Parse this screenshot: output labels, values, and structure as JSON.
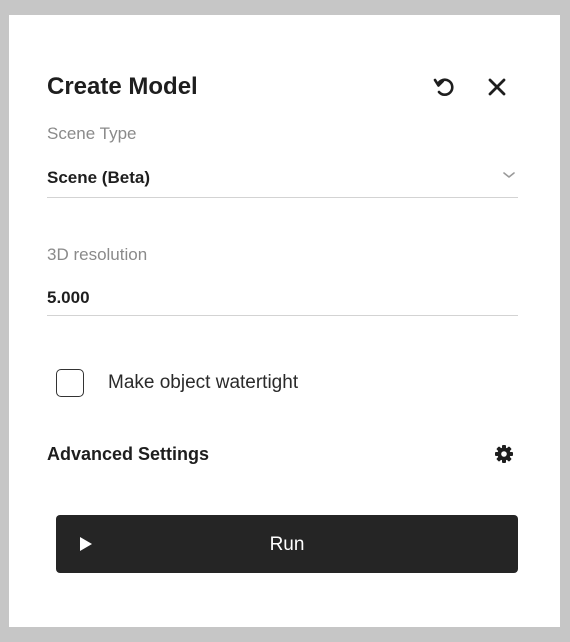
{
  "panel": {
    "title": "Create Model",
    "reset_icon": "undo-icon",
    "close_icon": "close-icon"
  },
  "scene_type": {
    "label": "Scene Type",
    "value": "Scene (Beta)",
    "icon": "chevron-down-icon"
  },
  "resolution": {
    "label": "3D resolution",
    "value": "5.000"
  },
  "watertight": {
    "label": "Make object watertight",
    "checked": false
  },
  "advanced": {
    "label": "Advanced Settings",
    "icon": "gear-icon"
  },
  "run": {
    "label": "Run",
    "icon": "play-icon"
  },
  "colors": {
    "background": "#c6c6c6",
    "panel": "#ffffff",
    "button": "#252525",
    "label": "#8a8a8a",
    "text": "#1e1e1e"
  }
}
